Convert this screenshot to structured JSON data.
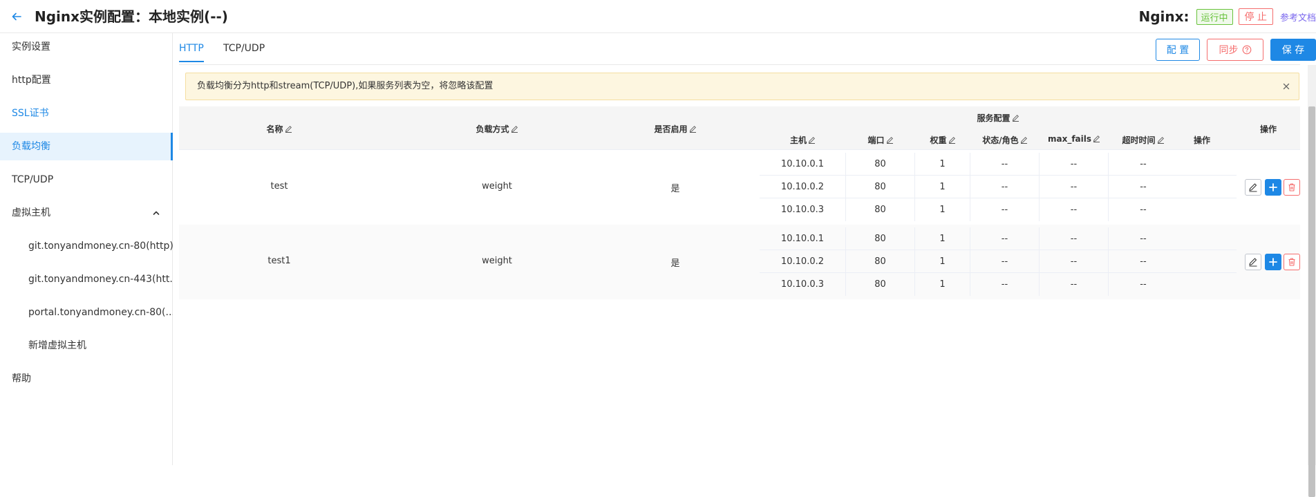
{
  "header": {
    "title": "Nginx实例配置：本地实例(--)",
    "nginx_label": "Nginx:",
    "status": "运行中",
    "stop_label": "停 止",
    "doc_link": "参考文档"
  },
  "sidebar": {
    "items": [
      {
        "label": "实例设置"
      },
      {
        "label": "http配置"
      },
      {
        "label": "SSL证书"
      },
      {
        "label": "负载均衡"
      },
      {
        "label": "TCP/UDP"
      },
      {
        "label": "虚拟主机"
      },
      {
        "label": "git.tonyandmoney.cn-80(http)"
      },
      {
        "label": "git.tonyandmoney.cn-443(htt..."
      },
      {
        "label": "portal.tonyandmoney.cn-80(..."
      },
      {
        "label": "新增虚拟主机"
      },
      {
        "label": "帮助"
      }
    ]
  },
  "tabs": [
    {
      "label": "HTTP"
    },
    {
      "label": "TCP/UDP"
    }
  ],
  "actions": {
    "config": "配 置",
    "sync": "同步",
    "save": "保 存"
  },
  "alert": {
    "message": "负载均衡分为http和stream(TCP/UDP),如果服务列表为空，将忽略该配置"
  },
  "table": {
    "headers": {
      "name": "名称",
      "method": "负载方式",
      "enabled": "是否启用",
      "service_config": "服务配置",
      "host": "主机",
      "port": "端口",
      "weight": "权重",
      "status": "状态/角色",
      "max_fails": "max_fails",
      "timeout": "超时时间",
      "sub_operation": "操作",
      "operation": "操作"
    },
    "rows": [
      {
        "name": "test",
        "method": "weight",
        "enabled": "是",
        "servers": [
          {
            "host": "10.10.0.1",
            "port": "80",
            "weight": "1",
            "status": "--",
            "max_fails": "--",
            "timeout": "--"
          },
          {
            "host": "10.10.0.2",
            "port": "80",
            "weight": "1",
            "status": "--",
            "max_fails": "--",
            "timeout": "--"
          },
          {
            "host": "10.10.0.3",
            "port": "80",
            "weight": "1",
            "status": "--",
            "max_fails": "--",
            "timeout": "--"
          }
        ]
      },
      {
        "name": "test1",
        "method": "weight",
        "enabled": "是",
        "servers": [
          {
            "host": "10.10.0.1",
            "port": "80",
            "weight": "1",
            "status": "--",
            "max_fails": "--",
            "timeout": "--"
          },
          {
            "host": "10.10.0.2",
            "port": "80",
            "weight": "1",
            "status": "--",
            "max_fails": "--",
            "timeout": "--"
          },
          {
            "host": "10.10.0.3",
            "port": "80",
            "weight": "1",
            "status": "--",
            "max_fails": "--",
            "timeout": "--"
          }
        ]
      }
    ]
  },
  "colors": {
    "primary": "#1e88e5",
    "danger": "#f56c6c",
    "success": "#67c23a",
    "alert_bg": "#fdf6e0"
  },
  "icons": {
    "back": "arrow-left-icon",
    "collapse": "chevron-up-icon",
    "close": "close-icon",
    "help": "help-circle-icon",
    "edit": "edit-icon",
    "add": "plus-icon",
    "delete": "trash-icon"
  }
}
